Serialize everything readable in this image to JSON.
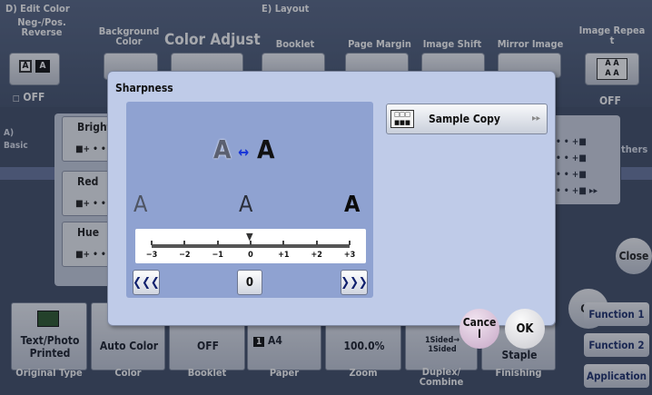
{
  "sections": {
    "edit_color": "D)  Edit Color",
    "layout": "E)  Layout",
    "basic": "A)\nBasic",
    "others": "thers"
  },
  "top_buttons": [
    {
      "label": "Neg-/Pos.\nReverse",
      "value": "OFF"
    },
    {
      "label": "Background\nColor"
    },
    {
      "label": "Color Adjust"
    },
    {
      "label": "Booklet"
    },
    {
      "label": "Page Margin"
    },
    {
      "label": "Image Shift"
    },
    {
      "label": "Mirror Image"
    },
    {
      "label": "Image Repea\nt",
      "value": "OFF"
    }
  ],
  "adjust_rows": [
    {
      "label": "Brightn",
      "value": "■+ • •"
    },
    {
      "label": "Red",
      "value": "■+ • •"
    },
    {
      "label": "Hue",
      "value": "■+ • •"
    }
  ],
  "right_rows": [
    "• • +■",
    "• • +■",
    "• • +■",
    "• • +■  ▸▸"
  ],
  "close_label": "Close",
  "bottom_buttons": [
    {
      "value": "Text/Photo\nPrinted",
      "label": "Original Type"
    },
    {
      "value": "Auto Color",
      "label": "Color"
    },
    {
      "value": "OFF",
      "label": "Booklet"
    },
    {
      "value": "A4",
      "label": "Paper",
      "tray": "1"
    },
    {
      "value": "100.0%",
      "label": "Zoom"
    },
    {
      "value": "1Sided→\n1Sided",
      "label": "Duplex/\nCombine"
    },
    {
      "value": "Staple",
      "label": "Finishing"
    }
  ],
  "function_buttons": [
    "Function 1",
    "Function 2",
    "Application"
  ],
  "ok_back": "OK",
  "dialog": {
    "title": "Sharpness",
    "sample_label": "Sample Copy",
    "compare_left": "A",
    "compare_right": "A",
    "compare_arrow": "↔",
    "levels": [
      "A",
      "A",
      "A"
    ],
    "ticks": [
      "−3",
      "−2",
      "−1",
      "0",
      "+1",
      "+2",
      "+3"
    ],
    "current_value": "0",
    "value_display": "0",
    "less_label": "❮❮❮",
    "more_label": "❯❯❯",
    "cancel_label": "Cance\nl",
    "ok_label": "OK"
  }
}
